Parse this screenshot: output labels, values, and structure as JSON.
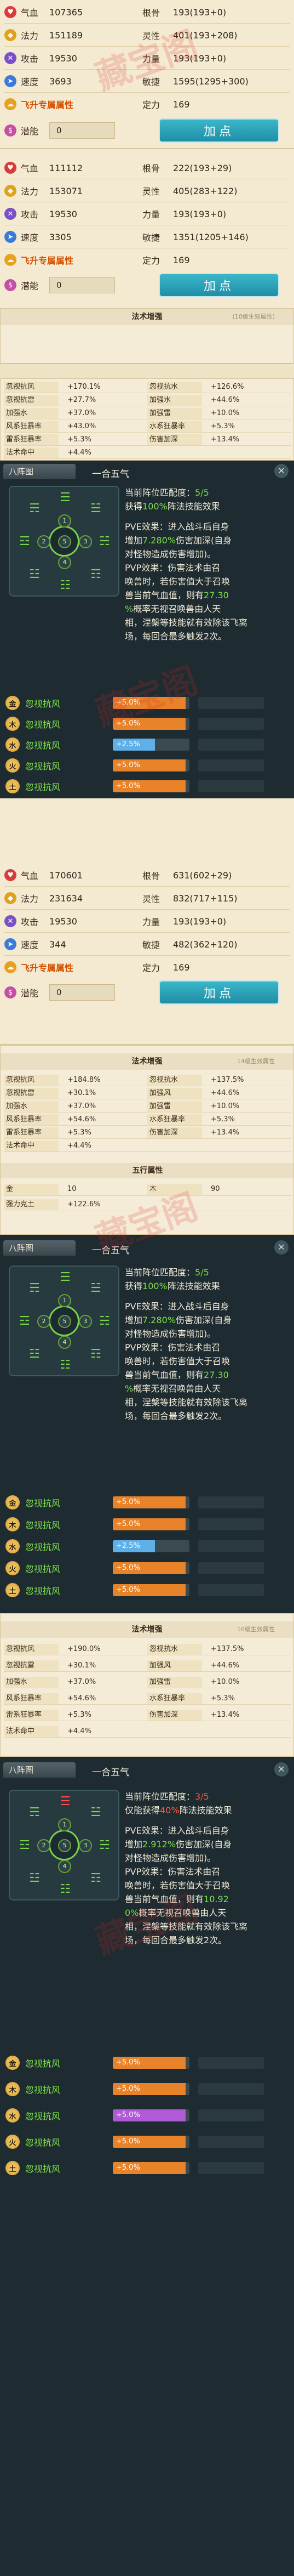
{
  "panels": [
    {
      "rows": [
        {
          "icon_color": "#d93a3a",
          "icon": "qixue-icon",
          "l_name": "气血",
          "l_val": "107365",
          "r_name": "根骨",
          "r_val": "193(193+0)"
        },
        {
          "icon_color": "#e0a21e",
          "icon": "fali-icon",
          "l_name": "法力",
          "l_val": "151189",
          "r_name": "灵性",
          "r_val": "401(193+208)"
        },
        {
          "icon_color": "#7a4fc8",
          "icon": "gongji-icon",
          "l_name": "攻击",
          "l_val": "19530",
          "r_name": "力量",
          "r_val": "193(193+0)"
        },
        {
          "icon_color": "#3a7ad8",
          "icon": "sudu-icon",
          "l_name": "速度",
          "l_val": "3693",
          "r_name": "敏捷",
          "r_val": "1595(1295+300)"
        }
      ],
      "flysheng": "飞升专属属性",
      "flysheng_r_name": "定力",
      "flysheng_r_val": "169",
      "potential_label": "潜能",
      "potential_val": "0",
      "button": "加点"
    },
    {
      "rows": [
        {
          "icon_color": "#d93a3a",
          "icon": "qixue-icon",
          "l_name": "气血",
          "l_val": "111112",
          "r_name": "根骨",
          "r_val": "222(193+29)"
        },
        {
          "icon_color": "#e0a21e",
          "icon": "fali-icon",
          "l_name": "法力",
          "l_val": "153071",
          "r_name": "灵性",
          "r_val": "405(283+122)"
        },
        {
          "icon_color": "#7a4fc8",
          "icon": "gongji-icon",
          "l_name": "攻击",
          "l_val": "19530",
          "r_name": "力量",
          "r_val": "193(193+0)"
        },
        {
          "icon_color": "#3a7ad8",
          "icon": "sudu-icon",
          "l_name": "速度",
          "l_val": "3305",
          "r_name": "敏捷",
          "r_val": "1351(1205+146)"
        }
      ],
      "flysheng": "飞升专属属性",
      "flysheng_r_name": "定力",
      "flysheng_r_val": "169",
      "potential_label": "潜能",
      "potential_val": "0",
      "button": "加点"
    },
    {
      "rows": [
        {
          "icon_color": "#d93a3a",
          "icon": "qixue-icon",
          "l_name": "气血",
          "l_val": "170601",
          "r_name": "根骨",
          "r_val": "631(602+29)"
        },
        {
          "icon_color": "#e0a21e",
          "icon": "fali-icon",
          "l_name": "法力",
          "l_val": "231634",
          "r_name": "灵性",
          "r_val": "832(717+115)"
        },
        {
          "icon_color": "#7a4fc8",
          "icon": "gongji-icon",
          "l_name": "攻击",
          "l_val": "19530",
          "r_name": "力量",
          "r_val": "193(193+0)"
        },
        {
          "icon_color": "#3a7ad8",
          "icon": "sudu-icon",
          "l_name": "速度",
          "l_val": "344",
          "r_name": "敏捷",
          "r_val": "482(362+120)"
        }
      ],
      "flysheng": "飞升专属属性",
      "flysheng_r_name": "定力",
      "flysheng_r_val": "169",
      "potential_label": "潜能",
      "potential_val": "0",
      "button": "加点"
    }
  ],
  "fx": [
    {
      "title": "法术增强",
      "sub": "(10级生效属性)",
      "rows": [
        [
          "忽视抗风",
          "+170.1%",
          "忽视抗水",
          "+126.6%"
        ],
        [
          "忽视抗雷",
          "+27.7%",
          "加强水",
          "+44.6%"
        ],
        [
          "加强水",
          "+37.0%",
          "加强雷",
          "+10.0%"
        ],
        [
          "风系狂暴率",
          "+43.0%",
          "水系狂暴率",
          "+5.3%"
        ],
        [
          "雷系狂暴率",
          "+5.3%",
          "伤害加深",
          "+13.4%"
        ],
        [
          "法术命中",
          "+4.4%",
          "",
          ""
        ]
      ]
    },
    {
      "title": "法术增强",
      "sub": "14级生效属性",
      "rows": [
        [
          "忽视抗风",
          "+184.8%",
          "忽视抗水",
          "+137.5%"
        ],
        [
          "忽视抗雷",
          "+30.1%",
          "加强风",
          "+44.6%"
        ],
        [
          "加强水",
          "+37.0%",
          "加强雷",
          "+10.0%"
        ],
        [
          "风系狂暴率",
          "+54.6%",
          "水系狂暴率",
          "+5.3%"
        ],
        [
          "雷系狂暴率",
          "+5.3%",
          "伤害加深",
          "+13.4%"
        ],
        [
          "法术命中",
          "+4.4%",
          "",
          ""
        ]
      ]
    },
    {
      "title": "法术增强",
      "sub": "10级生效属性",
      "rows": [
        [
          "忽视抗风",
          "+190.0%",
          "忽视抗水",
          "+137.5%"
        ],
        [
          "忽视抗雷",
          "+30.1%",
          "加强风",
          "+44.6%"
        ],
        [
          "加强水",
          "+37.0%",
          "加强雷",
          "+10.0%"
        ],
        [
          "风系狂暴率",
          "+54.6%",
          "水系狂暴率",
          "+5.3%"
        ],
        [
          "雷系狂暴率",
          "+5.3%",
          "伤害加深",
          "+13.4%"
        ],
        [
          "法术命中",
          "+4.4%",
          "",
          ""
        ]
      ]
    }
  ],
  "wuxing": {
    "title": "五行属性",
    "rows": [
      [
        "金",
        "10",
        "木",
        "90"
      ],
      [
        "强力克土",
        "+122.6%",
        "",
        ""
      ]
    ]
  },
  "formations": [
    {
      "tab": "八阵图",
      "name": "一合五气",
      "match_pre": "当前阵位匹配度：",
      "match": "5/5",
      "gain_pre": "获得",
      "gain": "100%",
      "gain_post": "阵法技能效果",
      "pve": [
        "PVE效果：进入战斗后自身",
        "增加",
        "7.280%",
        "伤害加深(自身",
        "对怪物造成伤害增加)。"
      ],
      "pvp": [
        "PVP效果：伤害法术由召",
        "唤兽时，若伤害值大于召唤",
        "兽当前气血值，则有",
        "27.30",
        "%",
        "概率无视召唤兽由人天",
        "相，涅槃等技能就有效除该飞离",
        "场，每回合最多触发2次。"
      ],
      "buffs": [
        {
          "badge": "金",
          "text": "忽视抗风",
          "bar": "+5.0%",
          "color": "#e8832a",
          "fill": 0.95
        },
        {
          "badge": "木",
          "text": "忽视抗风",
          "bar": "+5.0%",
          "color": "#e8832a",
          "fill": 0.95
        },
        {
          "badge": "水",
          "text": "忽视抗风",
          "bar": "+2.5%",
          "color": "#5fb0e8",
          "fill": 0.55
        },
        {
          "badge": "火",
          "text": "忽视抗风",
          "bar": "+5.0%",
          "color": "#e8832a",
          "fill": 0.95
        },
        {
          "badge": "土",
          "text": "忽视抗风",
          "bar": "+5.0%",
          "color": "#e8832a",
          "fill": 0.95
        }
      ]
    },
    {
      "tab": "八阵图",
      "name": "一合五气",
      "match_pre": "当前阵位匹配度：",
      "match": "5/5",
      "gain_pre": "获得",
      "gain": "100%",
      "gain_post": "阵法技能效果",
      "pve": [
        "PVE效果：进入战斗后自身",
        "增加",
        "7.280%",
        "伤害加深(自身",
        "对怪物造成伤害增加)。"
      ],
      "pvp": [
        "PVP效果：伤害法术由召",
        "唤兽时，若伤害值大于召唤",
        "兽当前气血值，则有",
        "27.30",
        "%",
        "概率无视召唤兽由人天",
        "相，涅槃等技能就有效除该飞离",
        "场，每回合最多触发2次。"
      ],
      "buffs": [
        {
          "badge": "金",
          "text": "忽视抗风",
          "bar": "+5.0%",
          "color": "#e8832a",
          "fill": 0.95
        },
        {
          "badge": "木",
          "text": "忽视抗风",
          "bar": "+5.0%",
          "color": "#e8832a",
          "fill": 0.95
        },
        {
          "badge": "水",
          "text": "忽视抗风",
          "bar": "+2.5%",
          "color": "#5fb0e8",
          "fill": 0.55
        },
        {
          "badge": "火",
          "text": "忽视抗风",
          "bar": "+5.0%",
          "color": "#e8832a",
          "fill": 0.95
        },
        {
          "badge": "土",
          "text": "忽视抗风",
          "bar": "+5.0%",
          "color": "#e8832a",
          "fill": 0.95
        }
      ]
    },
    {
      "tab": "八阵图",
      "name": "一合五气",
      "match_pre": "当前阵位匹配度：",
      "match": "3/5",
      "gain_pre": "仅能获得",
      "gain": "40%",
      "gain_post": "阵法技能效果",
      "pve": [
        "PVE效果：进入战斗后自身",
        "增加",
        "2.912%",
        "伤害加深(自身",
        "对怪物造成伤害增加)。"
      ],
      "pvp": [
        "PVP效果：伤害法术由召",
        "唤兽时，若伤害值大于召唤",
        "兽当前气血值，则有",
        "10.92",
        "0%",
        "概率无视召唤兽由人天",
        "相，涅槃等技能就有效除该飞离",
        "场，每回合最多触发2次。"
      ],
      "buffs": [
        {
          "badge": "金",
          "text": "忽视抗风",
          "bar": "+5.0%",
          "color": "#e8832a",
          "fill": 0.95
        },
        {
          "badge": "木",
          "text": "忽视抗风",
          "bar": "+5.0%",
          "color": "#e8832a",
          "fill": 0.95
        },
        {
          "badge": "水",
          "text": "忽视抗风",
          "bar": "+5.0%",
          "color": "#b05ad8",
          "fill": 0.95
        },
        {
          "badge": "火",
          "text": "忽视抗风",
          "bar": "+5.0%",
          "color": "#e8832a",
          "fill": 0.95
        },
        {
          "badge": "土",
          "text": "忽视抗风",
          "bar": "+5.0%",
          "color": "#e8832a",
          "fill": 0.95
        }
      ]
    }
  ],
  "watermark": "藏宝阁"
}
